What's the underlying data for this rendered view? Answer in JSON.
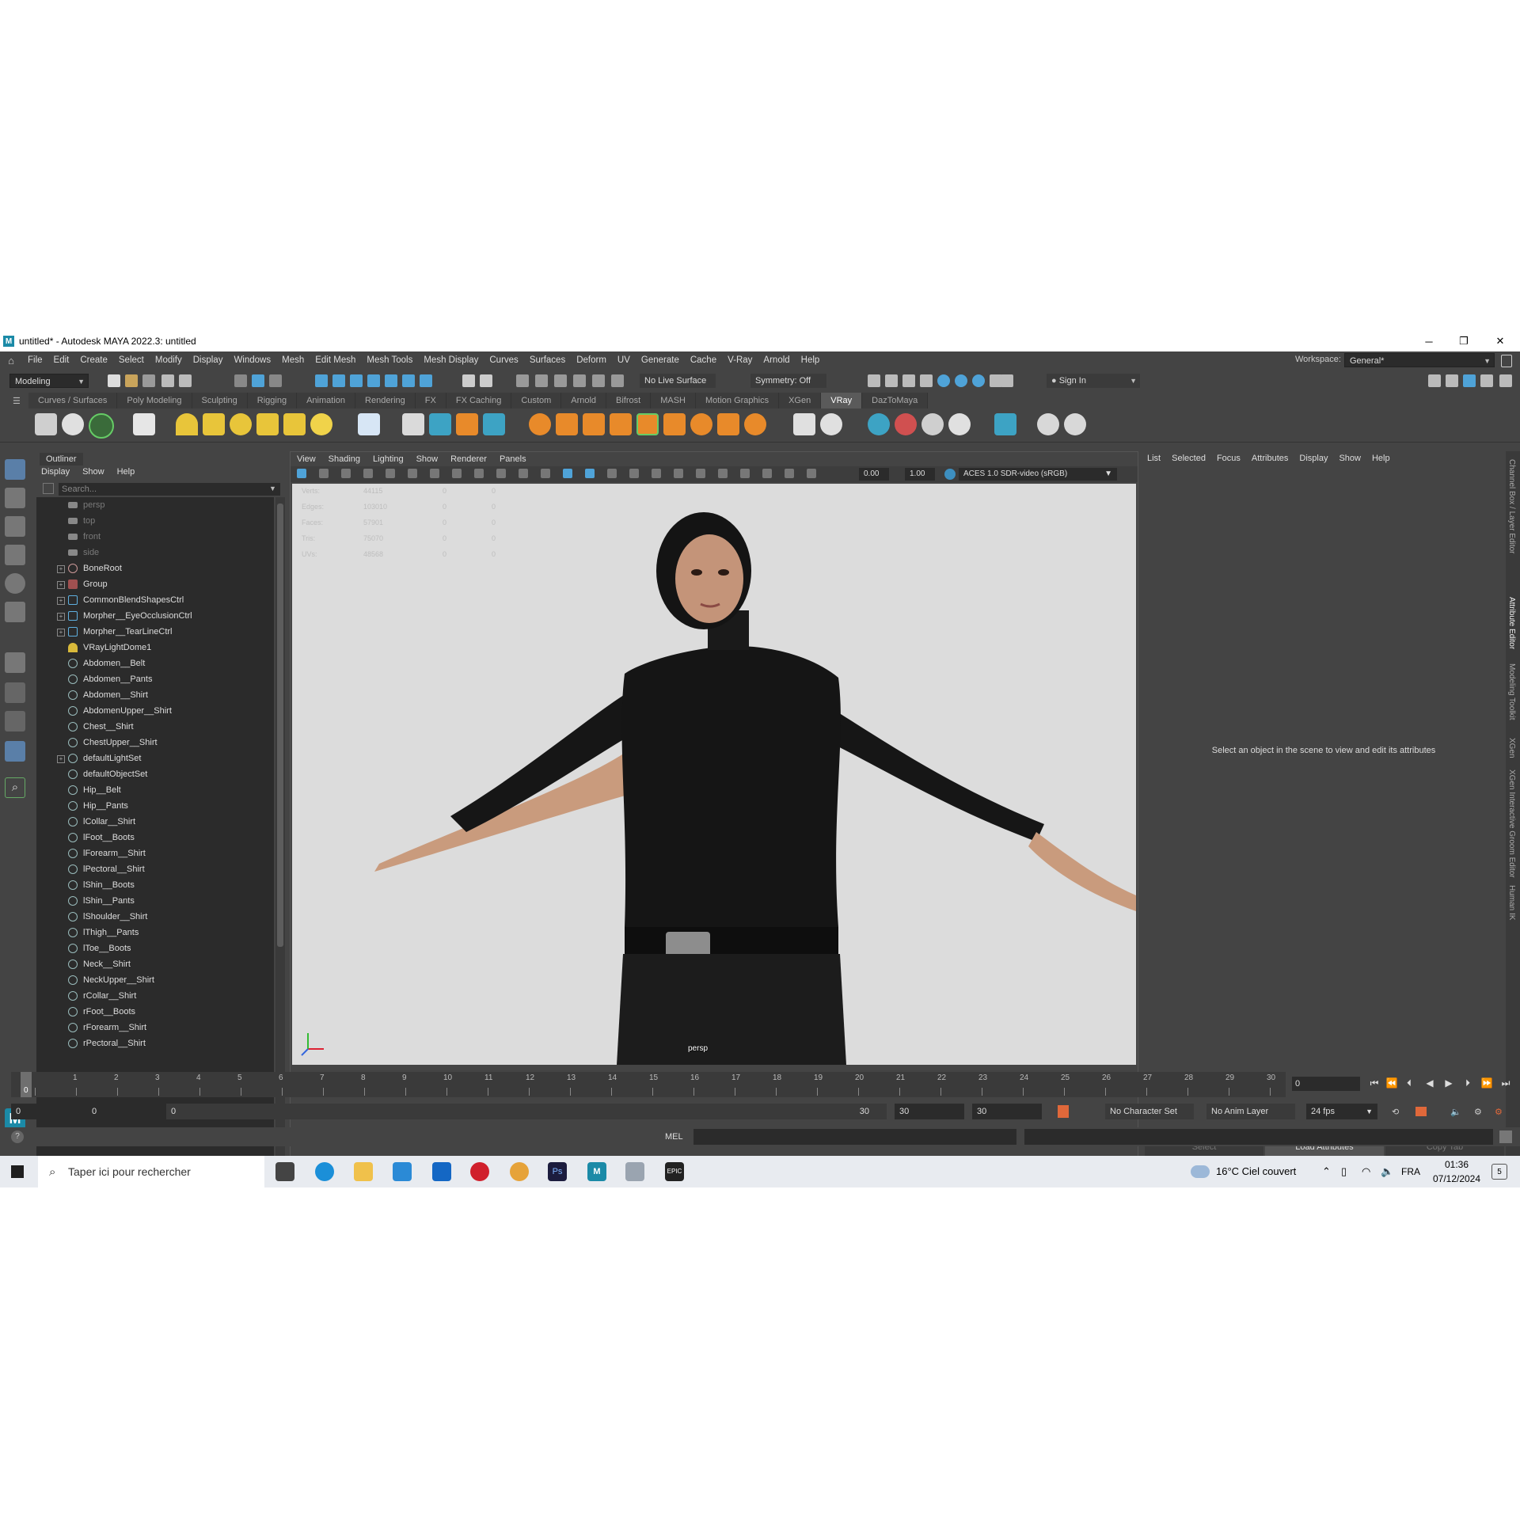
{
  "window": {
    "title": "untitled* - Autodesk MAYA 2022.3: untitled",
    "logo": "M"
  },
  "menubar": [
    "File",
    "Edit",
    "Create",
    "Select",
    "Modify",
    "Display",
    "Windows",
    "Mesh",
    "Edit Mesh",
    "Mesh Tools",
    "Mesh Display",
    "Curves",
    "Surfaces",
    "Deform",
    "UV",
    "Generate",
    "Cache",
    "V-Ray",
    "Arnold",
    "Help"
  ],
  "workspace": {
    "label": "Workspace:",
    "value": "General*"
  },
  "statusline": {
    "mode": "Modeling",
    "live_surface": "No Live Surface",
    "symmetry": "Symmetry: Off",
    "sign_in": "Sign In"
  },
  "shelf_tabs": [
    "Curves / Surfaces",
    "Poly Modeling",
    "Sculpting",
    "Rigging",
    "Animation",
    "Rendering",
    "FX",
    "FX Caching",
    "Custom",
    "Arnold",
    "Bifrost",
    "MASH",
    "Motion Graphics",
    "XGen",
    "VRay",
    "DazToMaya"
  ],
  "shelf_active": "VRay",
  "outliner": {
    "tab": "Outliner",
    "menu": [
      "Display",
      "Show",
      "Help"
    ],
    "search_placeholder": "Search...",
    "items": [
      {
        "label": "persp",
        "icon": "camera-icon",
        "dim": true
      },
      {
        "label": "top",
        "icon": "camera-icon",
        "dim": true
      },
      {
        "label": "front",
        "icon": "camera-icon",
        "dim": true
      },
      {
        "label": "side",
        "icon": "camera-icon",
        "dim": true
      },
      {
        "label": "BoneRoot",
        "icon": "joint-icon",
        "expand": true
      },
      {
        "label": "Group",
        "icon": "group-icon",
        "expand": true
      },
      {
        "label": "CommonBlendShapesCtrl",
        "icon": "curve-icon",
        "expand": true
      },
      {
        "label": "Morpher__EyeOcclusionCtrl",
        "icon": "curve-icon",
        "expand": true
      },
      {
        "label": "Morpher__TearLineCtrl",
        "icon": "curve-icon",
        "expand": true
      },
      {
        "label": "VRayLightDome1",
        "icon": "light-dome-icon"
      },
      {
        "label": "Abdomen__Belt",
        "icon": "mesh-icon"
      },
      {
        "label": "Abdomen__Pants",
        "icon": "mesh-icon"
      },
      {
        "label": "Abdomen__Shirt",
        "icon": "mesh-icon"
      },
      {
        "label": "AbdomenUpper__Shirt",
        "icon": "mesh-icon"
      },
      {
        "label": "Chest__Shirt",
        "icon": "mesh-icon"
      },
      {
        "label": "ChestUpper__Shirt",
        "icon": "mesh-icon"
      },
      {
        "label": "defaultLightSet",
        "icon": "set-icon",
        "expand": true
      },
      {
        "label": "defaultObjectSet",
        "icon": "set-icon"
      },
      {
        "label": "Hip__Belt",
        "icon": "mesh-icon"
      },
      {
        "label": "Hip__Pants",
        "icon": "mesh-icon"
      },
      {
        "label": "lCollar__Shirt",
        "icon": "mesh-icon"
      },
      {
        "label": "lFoot__Boots",
        "icon": "mesh-icon"
      },
      {
        "label": "lForearm__Shirt",
        "icon": "mesh-icon"
      },
      {
        "label": "lPectoral__Shirt",
        "icon": "mesh-icon"
      },
      {
        "label": "lShin__Boots",
        "icon": "mesh-icon"
      },
      {
        "label": "lShin__Pants",
        "icon": "mesh-icon"
      },
      {
        "label": "lShoulder__Shirt",
        "icon": "mesh-icon"
      },
      {
        "label": "lThigh__Pants",
        "icon": "mesh-icon"
      },
      {
        "label": "lToe__Boots",
        "icon": "mesh-icon"
      },
      {
        "label": "Neck__Shirt",
        "icon": "mesh-icon"
      },
      {
        "label": "NeckUpper__Shirt",
        "icon": "mesh-icon"
      },
      {
        "label": "rCollar__Shirt",
        "icon": "mesh-icon"
      },
      {
        "label": "rFoot__Boots",
        "icon": "mesh-icon"
      },
      {
        "label": "rForearm__Shirt",
        "icon": "mesh-icon"
      },
      {
        "label": "rPectoral__Shirt",
        "icon": "mesh-icon"
      }
    ]
  },
  "viewport": {
    "menu": [
      "View",
      "Shading",
      "Lighting",
      "Show",
      "Renderer",
      "Panels"
    ],
    "exposure": "0.00",
    "gamma": "1.00",
    "color_space": "ACES 1.0 SDR-video (sRGB)",
    "camera": "persp",
    "hud": [
      {
        "label": "Verts:",
        "v1": "44115",
        "v2": "0",
        "v3": "0"
      },
      {
        "label": "Edges:",
        "v1": "103010",
        "v2": "0",
        "v3": "0"
      },
      {
        "label": "Faces:",
        "v1": "57901",
        "v2": "0",
        "v3": "0"
      },
      {
        "label": "Tris:",
        "v1": "75070",
        "v2": "0",
        "v3": "0"
      },
      {
        "label": "UVs:",
        "v1": "48568",
        "v2": "0",
        "v3": "0"
      }
    ]
  },
  "attribute_editor": {
    "menu": [
      "List",
      "Selected",
      "Focus",
      "Attributes",
      "Display",
      "Show",
      "Help"
    ],
    "message": "Select an object in the scene to view and edit its attributes",
    "buttons": [
      "Select",
      "Load Attributes",
      "Copy Tab"
    ]
  },
  "side_tabs": [
    "Channel Box / Layer Editor",
    "Attribute Editor",
    "Modeling Toolkit",
    "XGen",
    "XGen Interactive Groom Editor",
    "Human IK"
  ],
  "timeline": {
    "ticks": [
      "0",
      "1",
      "2",
      "3",
      "4",
      "5",
      "6",
      "7",
      "8",
      "9",
      "10",
      "11",
      "12",
      "13",
      "14",
      "15",
      "16",
      "17",
      "18",
      "19",
      "20",
      "21",
      "22",
      "23",
      "24",
      "25",
      "26",
      "27",
      "28",
      "29",
      "30"
    ],
    "current_frame": "0",
    "frame_field": "0"
  },
  "range": {
    "start": "0",
    "anim_start": "0",
    "slider_start": "0",
    "slider_end": "30",
    "anim_end": "30",
    "end": "30",
    "character_set": "No Character Set",
    "anim_layer": "No Anim Layer",
    "fps": "24 fps"
  },
  "cmdline": {
    "lang": "MEL"
  },
  "taskbar": {
    "search": "Taper ici pour rechercher",
    "weather": "16°C  Ciel couvert",
    "lang": "FRA",
    "time": "01:36",
    "date": "07/12/2024",
    "notif": "5"
  }
}
